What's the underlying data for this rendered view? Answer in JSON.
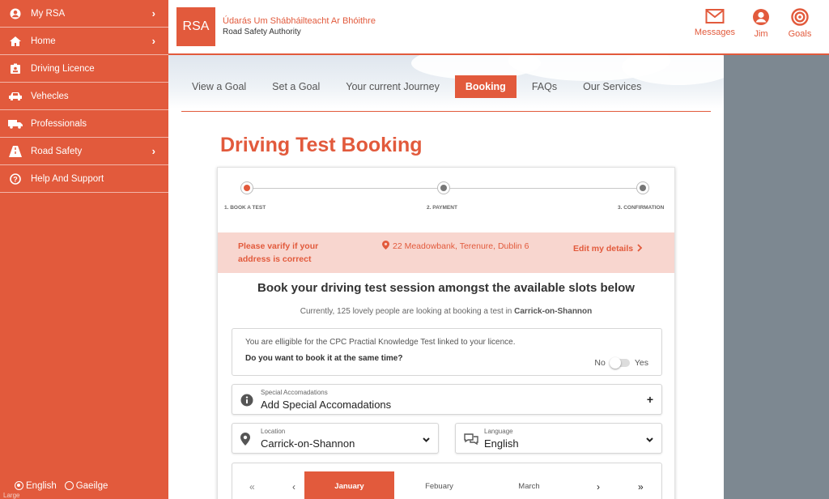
{
  "sidebar": {
    "items": [
      {
        "label": "My RSA",
        "icon": "user-circle-icon",
        "chevron": "›"
      },
      {
        "label": "Home",
        "icon": "home-icon",
        "chevron": "›"
      },
      {
        "label": "Driving Licence",
        "icon": "id-card-icon",
        "chevron": ""
      },
      {
        "label": "Vehecles",
        "icon": "car-icon",
        "chevron": ""
      },
      {
        "label": "Professionals",
        "icon": "truck-icon",
        "chevron": ""
      },
      {
        "label": "Road Safety",
        "icon": "road-icon",
        "chevron": "›"
      },
      {
        "label": "Help And Support",
        "icon": "help-icon",
        "chevron": ""
      }
    ],
    "lang_en": "English",
    "lang_ga": "Gaeilge",
    "large_label": "Large"
  },
  "header": {
    "logo_text": "RSA",
    "org_irish": "Údarás Um Shábháilteacht Ar Bhóithre",
    "org_english": "Road Safety Authority",
    "messages": "Messages",
    "user": "Jim",
    "goals": "Goals",
    "accent": "#e25a3c"
  },
  "tabs": [
    "View a Goal",
    "Set a Goal",
    "Your current Journey",
    "Booking",
    "FAQs",
    "Our Services"
  ],
  "page": {
    "title": "Driving Test Booking"
  },
  "steps": {
    "s1": "1. BOOK A TEST",
    "s2": "2. PAYMENT",
    "s3": "3. CONFIRMATION"
  },
  "verify": {
    "message": "Please varify if your address is correct",
    "address": "22 Meadowbank, Terenure, Dublin 6",
    "edit": "Edit my details"
  },
  "booking": {
    "heading": "Book your driving test session amongst the available slots below",
    "lookers_prefix": "Currently, 125 lovely people are looking at booking a test in",
    "lookers_place": "Carrick-on-Shannon"
  },
  "cpc": {
    "line1": "You are elligible for the CPC Practial Knowledge Test linked to your licence.",
    "line2": "Do you want to book it at the same time?",
    "no": "No",
    "yes": "Yes"
  },
  "special": {
    "small": "Special Accomadations",
    "value": "Add Special Accomadations"
  },
  "location": {
    "small": "Location",
    "value": "Carrick-on-Shannon"
  },
  "language": {
    "small": "Language",
    "value": "English"
  },
  "calendar": {
    "months": [
      "January",
      "Febuary",
      "March"
    ],
    "first": "«",
    "prev": "‹",
    "next": "›",
    "last": "»"
  }
}
